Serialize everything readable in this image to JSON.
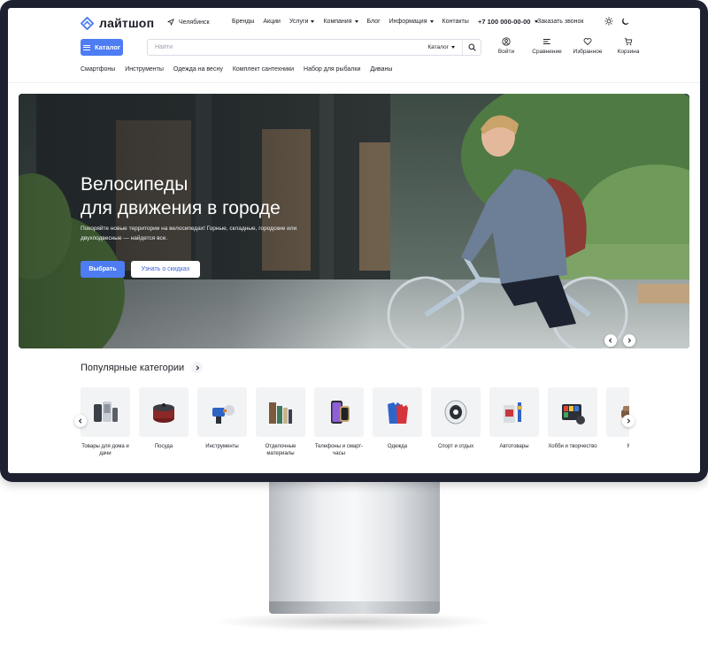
{
  "header": {
    "logo_text": "лайтшоп",
    "city": "Челябинск",
    "nav": [
      {
        "label": "Бренды",
        "has_dropdown": false
      },
      {
        "label": "Акции",
        "has_dropdown": false
      },
      {
        "label": "Услуги",
        "has_dropdown": true
      },
      {
        "label": "Компания",
        "has_dropdown": true
      },
      {
        "label": "Блог",
        "has_dropdown": false
      },
      {
        "label": "Информация",
        "has_dropdown": true
      },
      {
        "label": "Контакты",
        "has_dropdown": false
      }
    ],
    "phone": "+7 100 000-00-00",
    "callback_label": "Заказать звонок"
  },
  "toolbar": {
    "catalog_label": "Каталог",
    "search_placeholder": "Найти",
    "search_scope": "Каталог",
    "actions": [
      {
        "label": "Войти",
        "icon": "user-icon"
      },
      {
        "label": "Сравнение",
        "icon": "compare-icon"
      },
      {
        "label": "Избранное",
        "icon": "heart-icon"
      },
      {
        "label": "Корзина",
        "icon": "cart-icon"
      }
    ]
  },
  "category_nav": [
    "Смартфоны",
    "Инструменты",
    "Одежда на весну",
    "Комплект сантехники",
    "Набор для рыбалки",
    "Диваны"
  ],
  "hero": {
    "title_line1": "Велосипеды",
    "title_line2": "для движения в городе",
    "description": "Покоряйте новые территории на велосипедах! Горные, складные, городские или двухподвесные — найдется все.",
    "primary_button": "Выбрать",
    "secondary_button": "Узнать о скидках"
  },
  "popular": {
    "title": "Популярные категории",
    "items": [
      {
        "label": "Товары для дома и дачи",
        "icon": "kitchen-appliances-icon"
      },
      {
        "label": "Посуда",
        "icon": "cookware-icon"
      },
      {
        "label": "Инструменты",
        "icon": "tools-icon"
      },
      {
        "label": "Отделочные материалы",
        "icon": "building-materials-icon"
      },
      {
        "label": "Телефоны и смарт-часы",
        "icon": "smartphone-icon"
      },
      {
        "label": "Одежда",
        "icon": "clothing-icon"
      },
      {
        "label": "Спорт и отдых",
        "icon": "sports-icon"
      },
      {
        "label": "Автотовары",
        "icon": "car-goods-icon"
      },
      {
        "label": "Хобби и творчество",
        "icon": "hobby-icon"
      },
      {
        "label": "Ме",
        "icon": "furniture-icon"
      }
    ]
  },
  "colors": {
    "accent": "#4d7cf3",
    "monitor_bezel": "#1e2230",
    "text": "#1c1f26",
    "tile_bg": "#f2f3f5"
  }
}
